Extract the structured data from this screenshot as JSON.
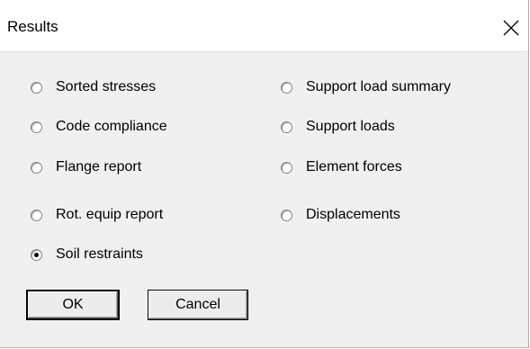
{
  "window": {
    "title": "Results"
  },
  "options_left": [
    {
      "label": "Sorted stresses",
      "checked": false
    },
    {
      "label": "Code compliance",
      "checked": false
    },
    {
      "label": "Flange report",
      "checked": false
    },
    {
      "label": "Rot. equip report",
      "checked": false
    },
    {
      "label": "Soil restraints",
      "checked": true
    }
  ],
  "options_right": [
    {
      "label": "Support load summary",
      "checked": false
    },
    {
      "label": "Support loads",
      "checked": false
    },
    {
      "label": "Element forces",
      "checked": false
    },
    {
      "label": "Displacements",
      "checked": false
    }
  ],
  "buttons": {
    "ok": "OK",
    "cancel": "Cancel"
  },
  "icons": {
    "close": "close-icon",
    "radio": "radio-icon"
  }
}
